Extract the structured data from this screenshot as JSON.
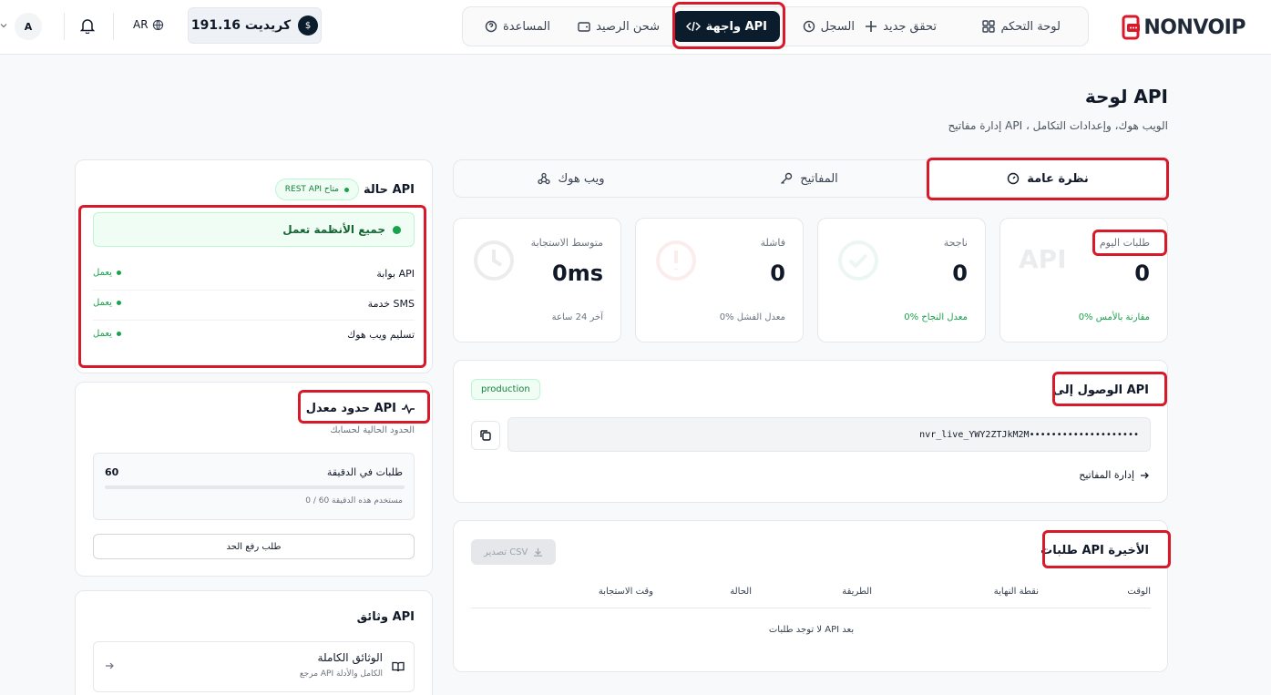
{
  "brand": {
    "logo_text": "NONVOIP"
  },
  "nav": {
    "dashboard": "لوحة التحكم",
    "new_verify": "تحقق جديد",
    "history": "السجل",
    "api": "واجهة API",
    "topup": "شحن الرصيد",
    "help": "المساعدة"
  },
  "header": {
    "balance": "191.16 كريديت",
    "lang": "AR",
    "avatar": "A"
  },
  "page": {
    "title": "لوحة API",
    "subtitle": "إدارة مفاتيح API ، الويب هوك، وإعدادات التكامل"
  },
  "tabs": {
    "overview": "نظرة عامة",
    "keys": "المفاتيح",
    "webhook": "ويب هوك"
  },
  "stats": [
    {
      "label": "طلبات اليوم",
      "value": "0",
      "note": "0% مقارنة بالأمس",
      "ghost": "API"
    },
    {
      "label": "ناجحة",
      "value": "0",
      "note": "0% معدل النجاح"
    },
    {
      "label": "فاشلة",
      "value": "0",
      "note": "0% معدل الفشل"
    },
    {
      "label": "متوسط الاستجابة",
      "value": "0ms",
      "note": "آخر 24 ساعة"
    }
  ],
  "access": {
    "title": "الوصول إلى API",
    "env": "production",
    "key": "nvr_live_YWY2ZTJkM2M••••••••••••••••••••",
    "manage": "إدارة المفاتيح"
  },
  "requests": {
    "title": "طلبات API الأخيرة",
    "export": "تصدير CSV",
    "cols": [
      "الوقت",
      "نقطة النهاية",
      "الطريقة",
      "الحالة",
      "وقت الاستجابة"
    ],
    "empty": "لا توجد طلبات API بعد"
  },
  "status": {
    "title": "حالة API",
    "badge": "REST API متاح",
    "banner": "جميع الأنظمة تعمل",
    "services": [
      {
        "name": "بوابة API",
        "state": "يعمل"
      },
      {
        "name": "خدمة SMS",
        "state": "يعمل"
      },
      {
        "name": "تسليم ويب هوك",
        "state": "يعمل"
      }
    ]
  },
  "limits": {
    "title": "حدود معدل API",
    "subtitle": "الحدود الحالية لحسابك",
    "label": "طلبات في الدقيقة",
    "max": "60",
    "used_text": "0 / 60 مستخدم هذه الدقيقة",
    "used_fraction": 0,
    "button": "طلب رفع الحد"
  },
  "docs": {
    "title": "وثائق API",
    "item_title": "الوثائق الكاملة",
    "item_sub": "مرجع API الكامل والأدلة"
  },
  "colors": {
    "navy": "#0b1c2c",
    "green": "#16a34a",
    "highlight": "#d8192a",
    "brand_red": "#d8192a"
  }
}
